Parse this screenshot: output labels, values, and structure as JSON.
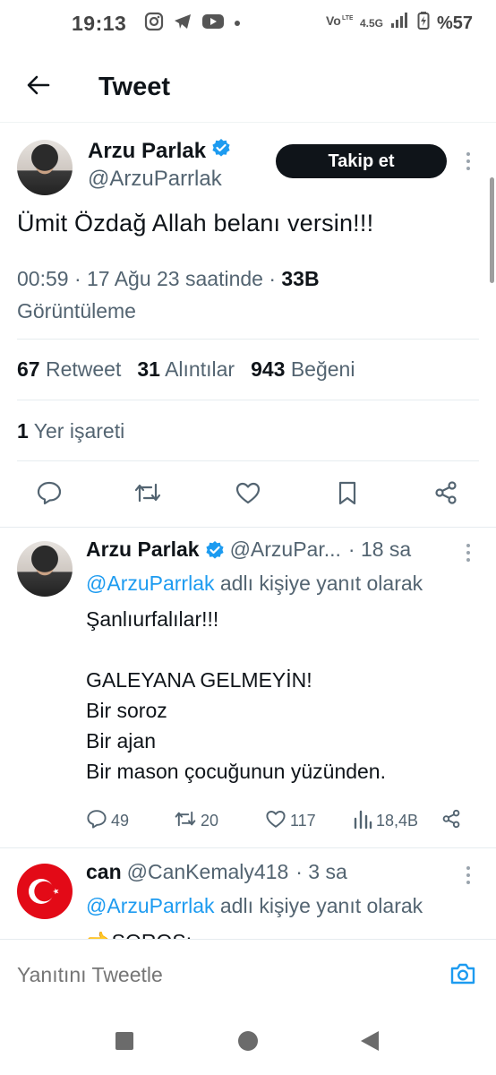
{
  "status_bar": {
    "time": "19:13",
    "network": "4.5G",
    "battery": "%57",
    "icons": [
      "instagram-icon",
      "telegram-icon",
      "youtube-icon",
      "dot-icon",
      "volte-icon",
      "signal-icon",
      "battery-icon"
    ]
  },
  "header": {
    "title": "Tweet",
    "back_icon": "arrow-left-icon"
  },
  "main_tweet": {
    "author_name": "Arzu Parlak",
    "author_handle": "@ArzuParrlak",
    "verified": true,
    "follow_label": "Takip et",
    "text": "Ümit Özdağ Allah belanı versin!!!",
    "time": "00:59 · 17 Ağu 23 saatinde · ",
    "views_count": "33B",
    "views_label": "Görüntüleme",
    "retweets_count": "67",
    "retweets_label": "Retweet",
    "quotes_count": "31",
    "quotes_label": "Alıntılar",
    "likes_count": "943",
    "likes_label": "Beğeni",
    "bookmarks_count": "1",
    "bookmarks_label": "Yer işareti"
  },
  "replies": [
    {
      "author_name": "Arzu Parlak",
      "author_handle": "@ArzuPar...",
      "time": "· 18 sa",
      "verified": true,
      "reply_to_mention": "@ArzuParrlak",
      "reply_to_suffix": " adlı kişiye yanıt olarak",
      "lines": [
        "Şanlıurfalılar!!!",
        "",
        "GALEYANA GELMEYİN!",
        "Bir soroz",
        "Bir ajan",
        "Bir mason çocuğunun yüzünden."
      ],
      "reply_count": "49",
      "retweet_count": "20",
      "like_count": "117",
      "view_count": "18,4B"
    },
    {
      "author_name": "can",
      "author_handle": "@CanKemaly418",
      "time": "· 3 sa",
      "verified": false,
      "reply_to_mention": "@ArzuParrlak",
      "reply_to_suffix": " adlı kişiye yanıt olarak",
      "partial_text": "👈SOROS:"
    }
  ],
  "compose": {
    "placeholder": "Yanıtını Tweetle"
  },
  "colors": {
    "accent": "#1d9bf0",
    "text_primary": "#0f1419",
    "text_secondary": "#536471",
    "divider": "#eff3f4",
    "follow_button": "#0f1419",
    "turkish_flag": "#e30a17"
  }
}
